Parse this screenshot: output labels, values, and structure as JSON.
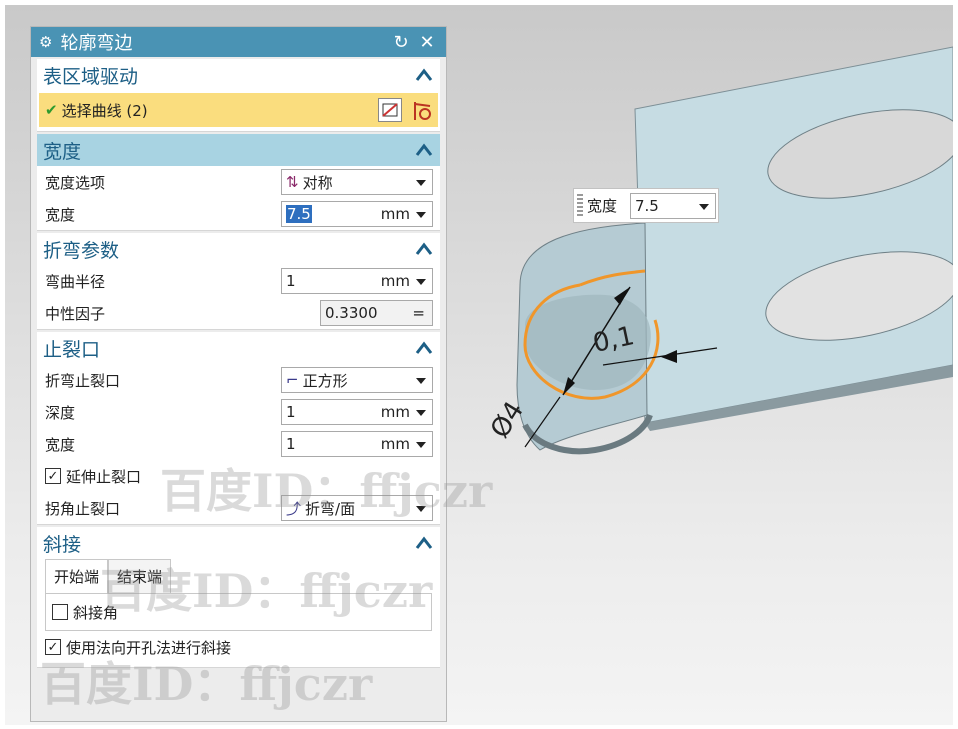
{
  "dialog": {
    "title": "轮廓弯边",
    "reset_icon": "reset-icon",
    "close_icon": "close-icon"
  },
  "sections": {
    "drive": {
      "title": "表区域驱动",
      "select_label": "选择曲线 (2)"
    },
    "width": {
      "title": "宽度",
      "option_label": "宽度选项",
      "option_value": "对称",
      "width_label": "宽度",
      "width_value": "7.5",
      "width_unit": "mm"
    },
    "bend": {
      "title": "折弯参数",
      "radius_label": "弯曲半径",
      "radius_value": "1",
      "radius_unit": "mm",
      "neutral_label": "中性因子",
      "neutral_value": "0.3300",
      "neutral_op": "="
    },
    "relief": {
      "title": "止裂口",
      "bend_relief_label": "折弯止裂口",
      "bend_relief_value": "正方形",
      "depth_label": "深度",
      "depth_value": "1",
      "depth_unit": "mm",
      "width_label": "宽度",
      "width_value": "1",
      "width_unit": "mm",
      "extend_label": "延伸止裂口",
      "extend_checked": true,
      "corner_label": "拐角止裂口",
      "corner_value": "折弯/面"
    },
    "miter": {
      "title": "斜接",
      "tab_start": "开始端",
      "tab_end": "结束端",
      "miter_angle_label": "斜接角",
      "miter_angle_checked": false,
      "normal_label": "使用法向开孔法进行斜接",
      "normal_checked": true
    }
  },
  "viewport": {
    "float_label": "宽度",
    "float_value": "7.5",
    "dim_thickness": "0,1",
    "dim_diameter": "Ø4"
  },
  "watermark": "百度ID：ffjczr",
  "colors": {
    "title_bar": "#4a93b4",
    "selection": "#fadd7e",
    "section_active": "#a8d3e2",
    "part": "#c6dce3",
    "curve": "#f0962a"
  }
}
